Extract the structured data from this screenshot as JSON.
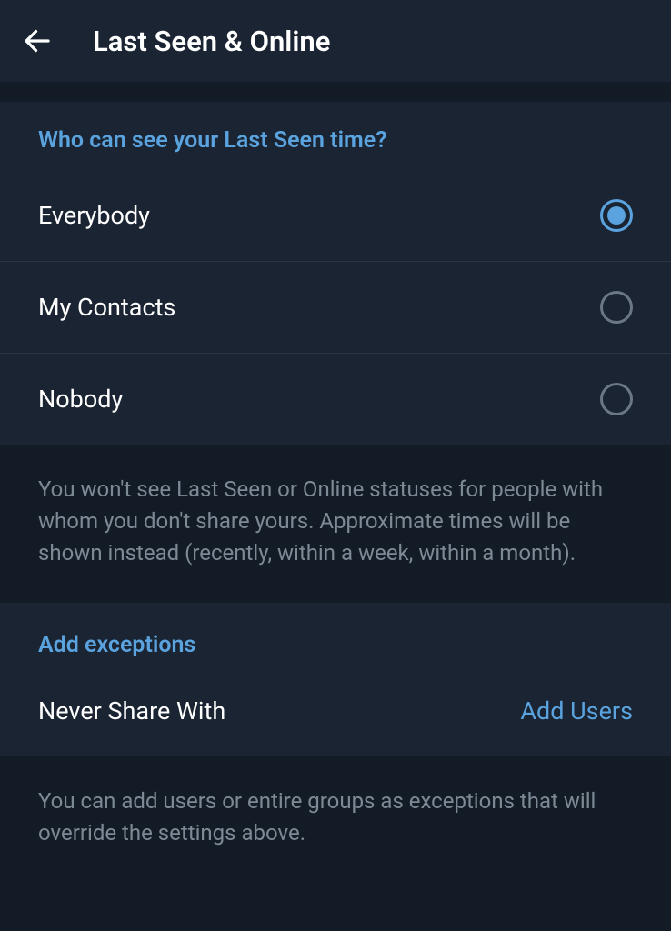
{
  "header": {
    "title": "Last Seen & Online"
  },
  "visibility": {
    "section_title": "Who can see your Last Seen time?",
    "options": [
      {
        "label": "Everybody",
        "selected": true
      },
      {
        "label": "My Contacts",
        "selected": false
      },
      {
        "label": "Nobody",
        "selected": false
      }
    ],
    "description": "You won't see Last Seen or Online statuses for people with whom you don't share yours. Approximate times will be shown instead (recently, within a week, within a month)."
  },
  "exceptions": {
    "section_title": "Add exceptions",
    "never_share_label": "Never Share With",
    "add_users_label": "Add Users",
    "description": "You can add users or entire groups as exceptions that will override the settings above."
  }
}
